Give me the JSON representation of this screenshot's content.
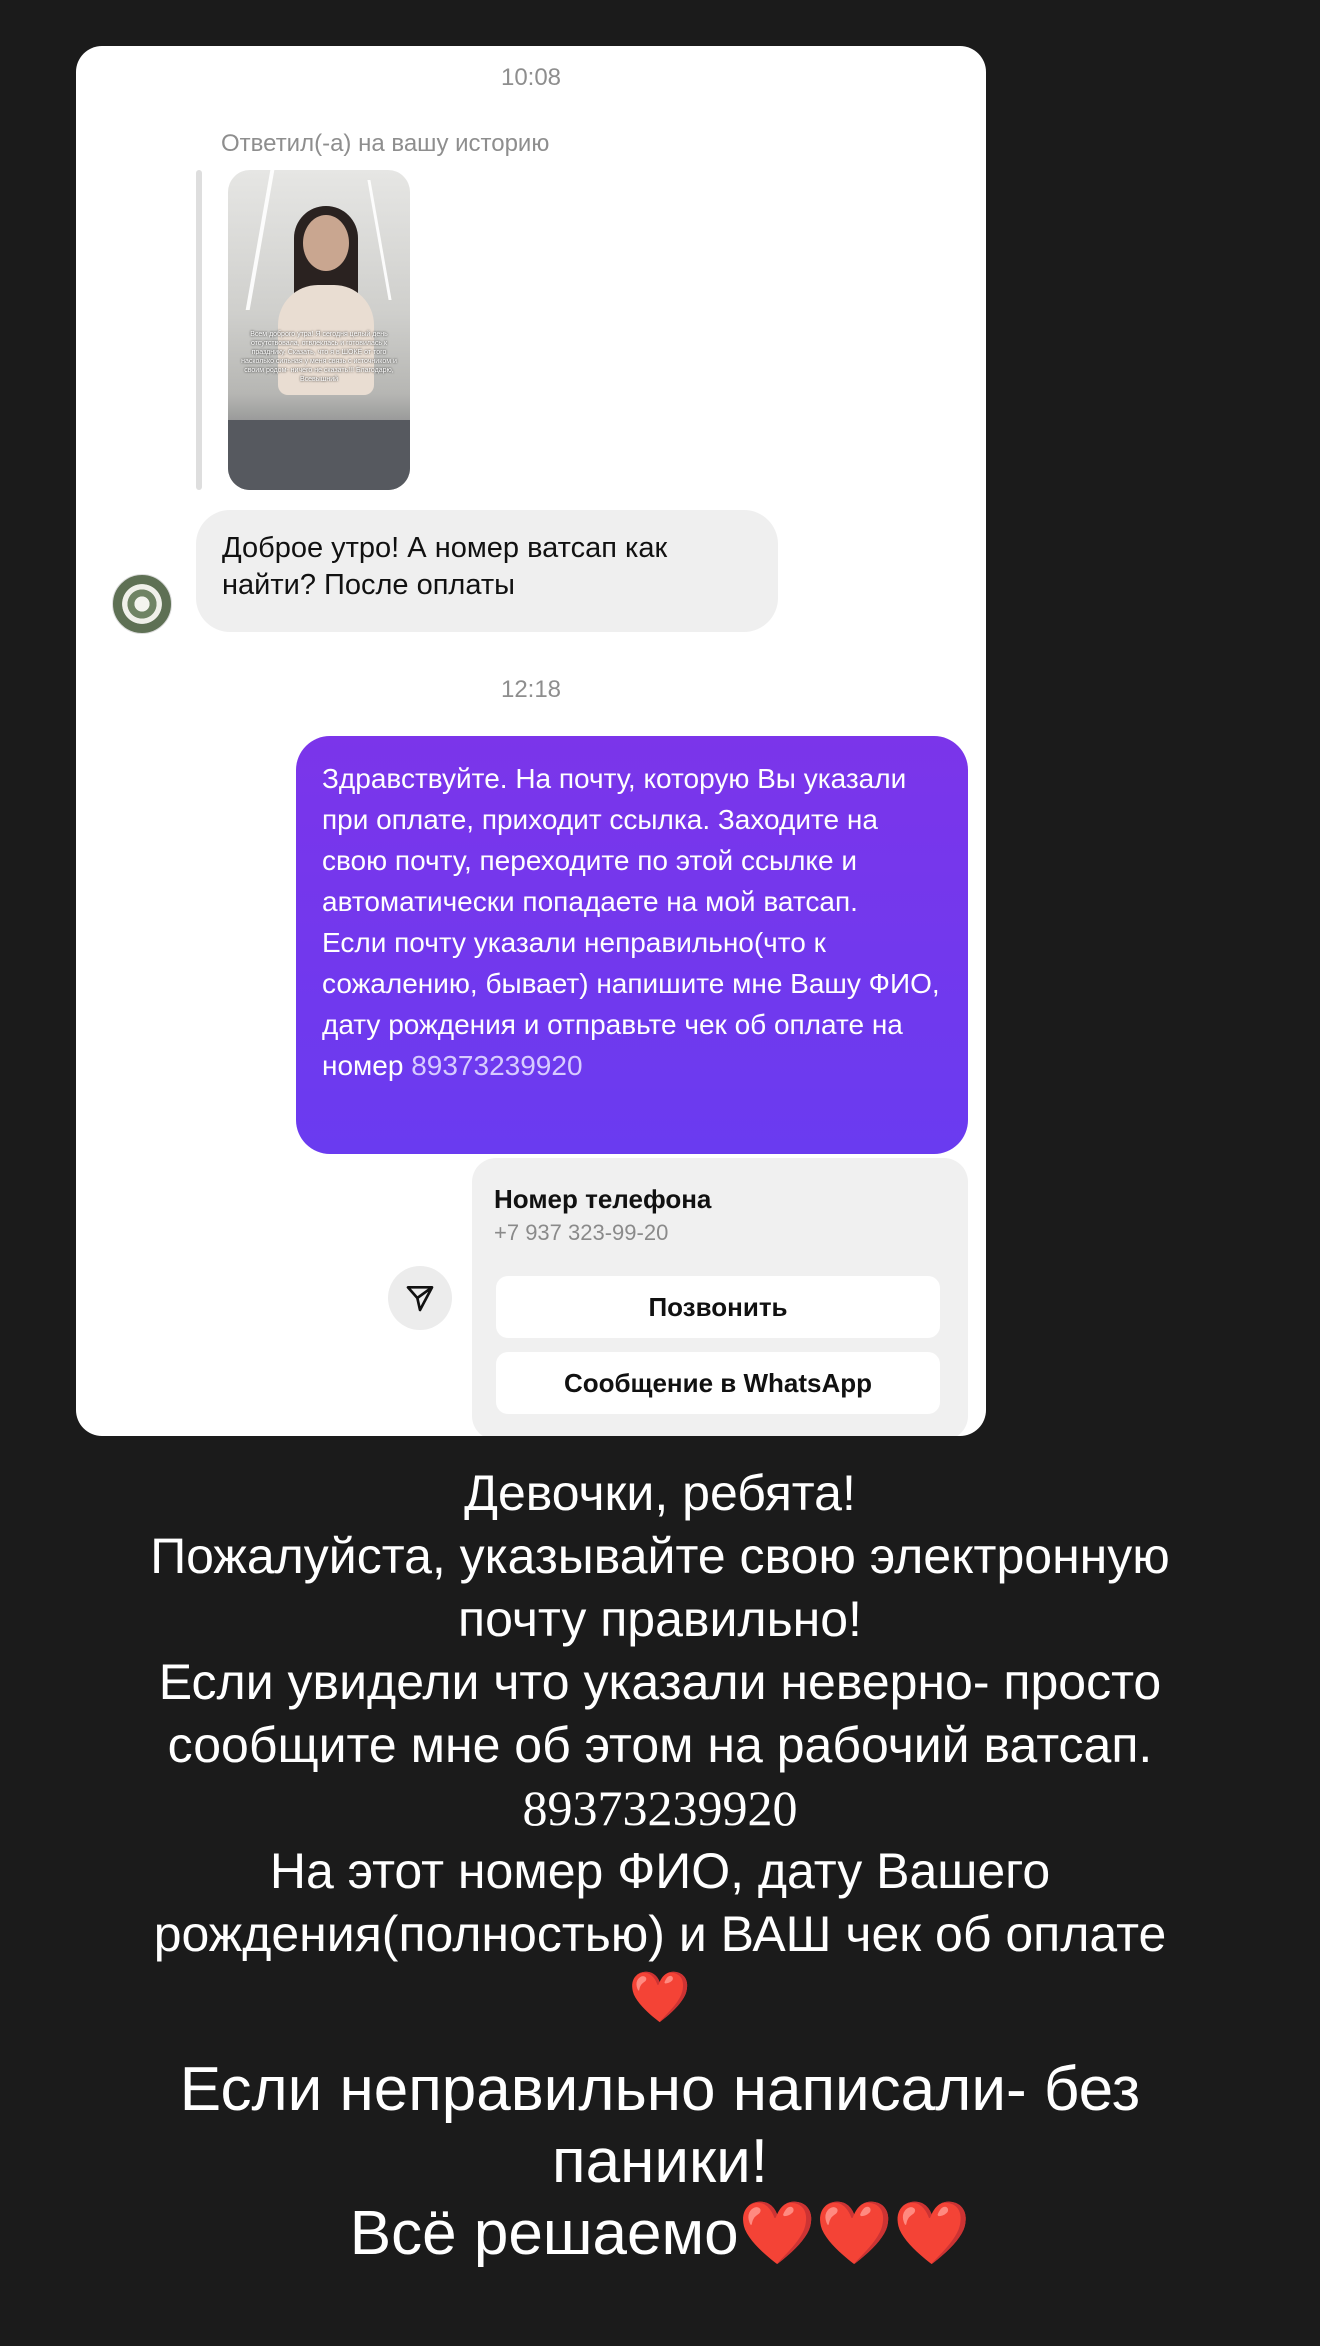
{
  "chat": {
    "time_1": "10:08",
    "replied_label": "Ответил(-а) на вашу историю",
    "story_overlay": "Всем доброго утра! Я сегодня целый день отсутствовала, отвлеклась и готовилась к празднику. Сказать, что я в ШОКЕ от того насколько сильная у меня связь с источником и своим родом- ничего не сказать!!! Благодарю, Всевышний",
    "incoming_message": "Доброе утро! А номер ватсап как найти? После оплаты",
    "time_2": "12:18",
    "outgoing_part_1": "Здравствуйте. На почту, которую Вы указали при оплате, приходит ссылка. Заходите на свою почту, переходите по этой ссылке и автоматически попадаете на мой ватсап.",
    "outgoing_part_2": "Если почту указали неправильно(что к сожалению, бывает) напишите мне Вашу ФИО, дату рождения и отправьте чек об оплате на номер",
    "outgoing_number": "89373239920",
    "contact_card": {
      "title": "Номер телефона",
      "phone": "+7 937 323-99-20",
      "call_button": "Позвонить",
      "whatsapp_button": "Сообщение в WhatsApp"
    },
    "share_icon": "send-icon"
  },
  "caption": {
    "line_1": "Девочки, ребята!",
    "line_2": "Пожалуйста, указывайте свою электронную",
    "line_3": "почту правильно!",
    "line_4": "Если увидели что указали неверно- просто",
    "line_5": "сообщите мне об этом на рабочий ватсап.",
    "line_6": "89373239920",
    "line_7": "На этот номер ФИО, дату Вашего",
    "line_8": "рождения(полностью) и ВАШ чек об оплате",
    "heart": "❤️",
    "big_line_1": "Если неправильно написали- без",
    "big_line_2": "паники!",
    "big_line_3": "Всё решаемо",
    "big_hearts": "❤️❤️❤️"
  },
  "colors": {
    "background": "#1b1b1b",
    "outgoing_bubble": "#6f38ee",
    "incoming_bubble": "#efefef",
    "heart": "#e0191f"
  }
}
